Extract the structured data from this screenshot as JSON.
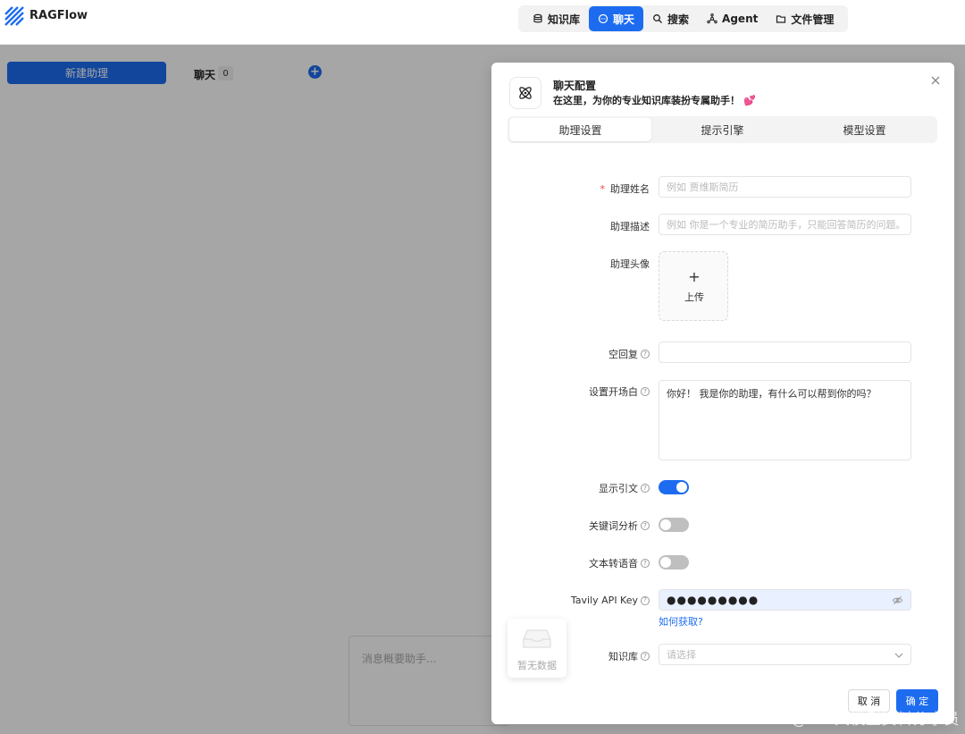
{
  "app": {
    "brand": "RAGFlow"
  },
  "nav": {
    "items": [
      {
        "label": "知识库",
        "icon": "database-icon"
      },
      {
        "label": "聊天",
        "icon": "chat-icon",
        "active": true
      },
      {
        "label": "搜索",
        "icon": "search-icon"
      },
      {
        "label": "Agent",
        "icon": "agent-icon"
      },
      {
        "label": "文件管理",
        "icon": "folder-icon"
      }
    ]
  },
  "left": {
    "new_assistant": "新建助理",
    "chat_label": "聊天",
    "chat_count": "0",
    "message_placeholder": "消息概要助手...",
    "no_data": "暂无数据"
  },
  "modal": {
    "title": "聊天配置",
    "subtitle": "在这里，为你的专业知识库装扮专属助手！",
    "subtitle_emoji": "💕",
    "tabs": [
      "助理设置",
      "提示引擎",
      "模型设置"
    ],
    "fields": {
      "name": {
        "label": "助理姓名",
        "placeholder": "例如 贾维斯简历"
      },
      "description": {
        "label": "助理描述",
        "placeholder": "例如 你是一个专业的简历助手，只能回答简历的问题。"
      },
      "avatar": {
        "label": "助理头像",
        "upload_plus": "+",
        "upload_text": "上传"
      },
      "empty_reply": {
        "label": "空回复",
        "value": ""
      },
      "opener": {
        "label": "设置开场白",
        "value": "你好！ 我是你的助理，有什么可以帮到你的吗？"
      },
      "show_quote": {
        "label": "显示引文",
        "on": true
      },
      "keyword": {
        "label": "关键词分析",
        "on": false
      },
      "tts": {
        "label": "文本转语音",
        "on": false
      },
      "tavily": {
        "label": "Tavily API Key",
        "value": "●●●●●●●●●",
        "help_link": "如何获取?"
      },
      "kb": {
        "label": "知识库",
        "placeholder": "请选择"
      }
    },
    "cancel": "取 消",
    "ok": "确 定"
  },
  "watermark": "CSDN @AGI大模型资料分享员",
  "colors": {
    "accent": "#1d6cf0"
  }
}
